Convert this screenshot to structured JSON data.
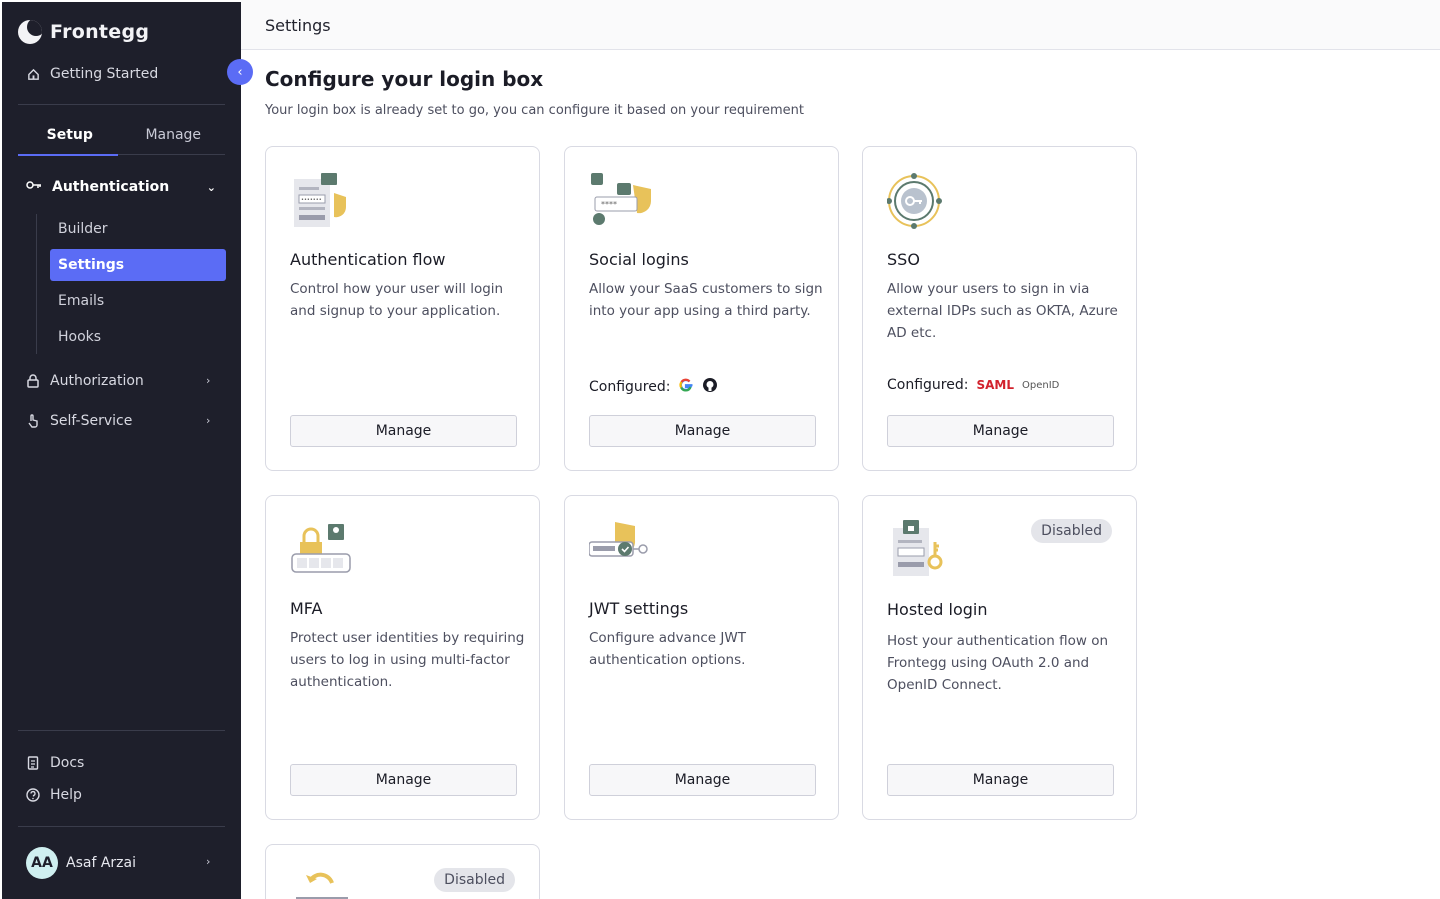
{
  "sidebar": {
    "brand": "Frontegg",
    "getting_started": "Getting Started",
    "tabs": [
      {
        "label": "Setup",
        "active": true
      },
      {
        "label": "Manage",
        "active": false
      }
    ],
    "section": "Authentication",
    "sub_items": [
      {
        "label": "Builder",
        "active": false
      },
      {
        "label": "Settings",
        "active": true
      },
      {
        "label": "Emails",
        "active": false
      },
      {
        "label": "Hooks",
        "active": false
      }
    ],
    "authorization": "Authorization",
    "self_service": "Self-Service",
    "docs": "Docs",
    "help": "Help",
    "user": {
      "initials": "AA",
      "name": "Asaf Arzai"
    }
  },
  "topbar": {
    "title": "Settings"
  },
  "main": {
    "title": "Configure your login box",
    "subtitle": "Your login box is already set to go, you can configure it based on your requirement"
  },
  "cards": [
    {
      "title": "Authentication flow",
      "desc": "Control how your user will login and signup to your application.",
      "button": "Manage"
    },
    {
      "title": "Social logins",
      "desc": "Allow your SaaS customers to sign into your app using a third party.",
      "configured": "Configured:",
      "button": "Manage"
    },
    {
      "title": "SSO",
      "desc": "Allow your users to sign in via external IDPs such as OKTA, Azure AD etc.",
      "configured": "Configured:",
      "saml": "SAML",
      "openid": "OpenID",
      "button": "Manage"
    },
    {
      "title": "MFA",
      "desc": "Protect user identities by requiring users to log in using multi-factor authentication.",
      "button": "Manage"
    },
    {
      "title": "JWT settings",
      "desc": "Configure advance JWT authentication options.",
      "button": "Manage"
    },
    {
      "title": "Hosted login",
      "desc": "Host your authentication flow on Frontegg using OAuth 2.0 and OpenID Connect.",
      "badge": "Disabled",
      "button": "Manage"
    },
    {
      "badge": "Disabled"
    }
  ],
  "colors": {
    "sidebar_bg": "#1e1f2b",
    "accent": "#5b6cf5",
    "gold": "#e8c25a"
  }
}
